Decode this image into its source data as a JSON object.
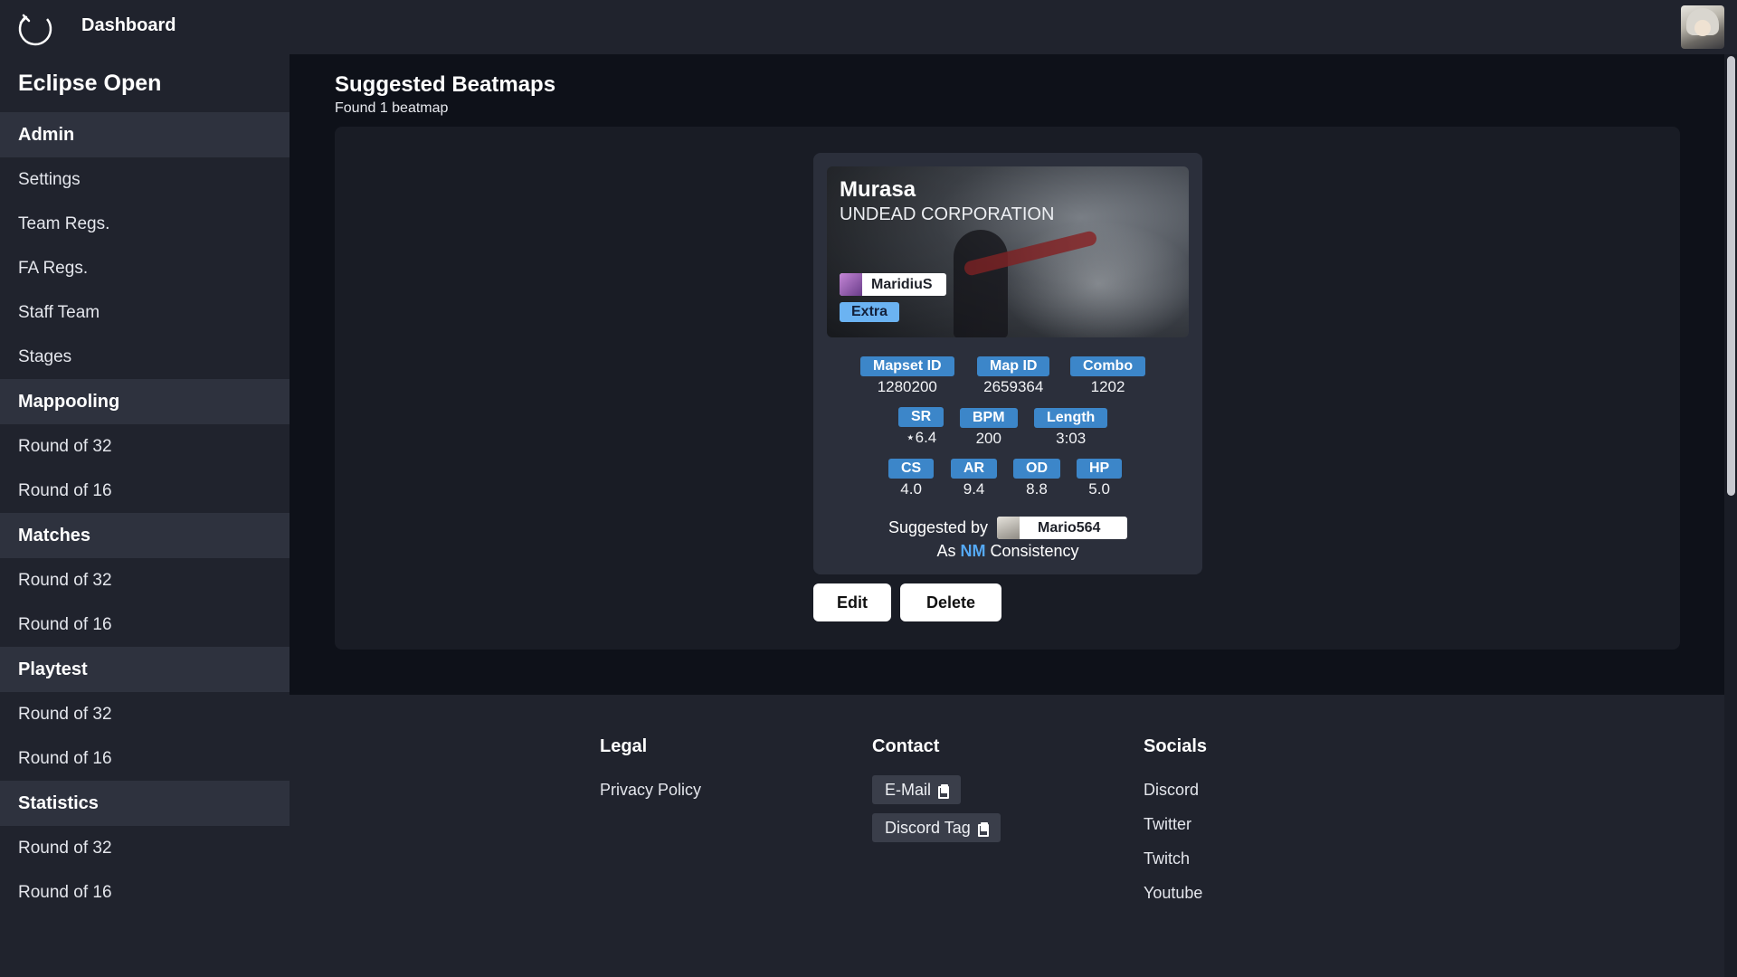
{
  "topbar": {
    "title": "Dashboard",
    "logo_icon": "eclipse-logo-icon"
  },
  "sidebar": {
    "title": "Eclipse Open",
    "sections": [
      {
        "label": "Admin",
        "items": [
          "Settings",
          "Team Regs.",
          "FA Regs.",
          "Staff Team",
          "Stages"
        ]
      },
      {
        "label": "Mappooling",
        "items": [
          "Round of 32",
          "Round of 16"
        ]
      },
      {
        "label": "Matches",
        "items": [
          "Round of 32",
          "Round of 16"
        ]
      },
      {
        "label": "Playtest",
        "items": [
          "Round of 32",
          "Round of 16"
        ]
      },
      {
        "label": "Statistics",
        "items": [
          "Round of 32",
          "Round of 16"
        ]
      }
    ]
  },
  "main": {
    "title": "Suggested Beatmaps",
    "subtitle": "Found 1 beatmap",
    "beatmap": {
      "title": "Murasa",
      "artist": "UNDEAD CORPORATION",
      "mapper": "MaridiuS",
      "difficulty": "Extra",
      "stats": {
        "mapset_id": {
          "label": "Mapset ID",
          "value": "1280200"
        },
        "map_id": {
          "label": "Map ID",
          "value": "2659364"
        },
        "combo": {
          "label": "Combo",
          "value": "1202"
        },
        "sr": {
          "label": "SR",
          "value": "⋆6.4"
        },
        "bpm": {
          "label": "BPM",
          "value": "200"
        },
        "length": {
          "label": "Length",
          "value": "3:03"
        },
        "cs": {
          "label": "CS",
          "value": "4.0"
        },
        "ar": {
          "label": "AR",
          "value": "9.4"
        },
        "od": {
          "label": "OD",
          "value": "8.8"
        },
        "hp": {
          "label": "HP",
          "value": "5.0"
        }
      },
      "suggested_by_label": "Suggested by",
      "suggested_by": "Mario564",
      "as_prefix": "As",
      "mod": "NM",
      "as_suffix": "Consistency"
    },
    "edit_label": "Edit",
    "delete_label": "Delete"
  },
  "footer": {
    "legal": {
      "heading": "Legal",
      "links": [
        "Privacy Policy"
      ]
    },
    "contact": {
      "heading": "Contact",
      "email_label": "E-Mail",
      "discord_label": "Discord Tag"
    },
    "socials": {
      "heading": "Socials",
      "links": [
        "Discord",
        "Twitter",
        "Twitch",
        "Youtube"
      ]
    }
  },
  "colors": {
    "accent": "#3c86c9",
    "mod_nm": "#55a9f5",
    "difficulty_badge": "#6bb3f2"
  }
}
